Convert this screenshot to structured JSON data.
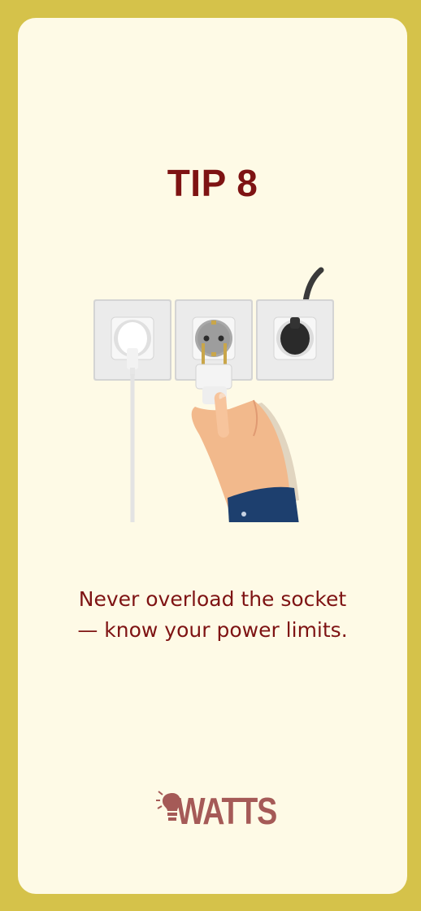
{
  "card": {
    "title": "TIP 8",
    "tip_lines": [
      "Never overload the socket",
      "— know your power limits."
    ]
  },
  "illustration": {
    "subject": "hand plugging a plug into a triple wall socket",
    "icons": [
      "wall-socket-icon",
      "plug-icon",
      "hand-icon"
    ]
  },
  "brand": {
    "logo_text": "WATTS",
    "logo_icon": "lightbulb-icon"
  },
  "colors": {
    "frame": "#d5c24a",
    "card_background": "#fefae6",
    "title_text": "#7e1313",
    "logo": "#a55a57"
  }
}
